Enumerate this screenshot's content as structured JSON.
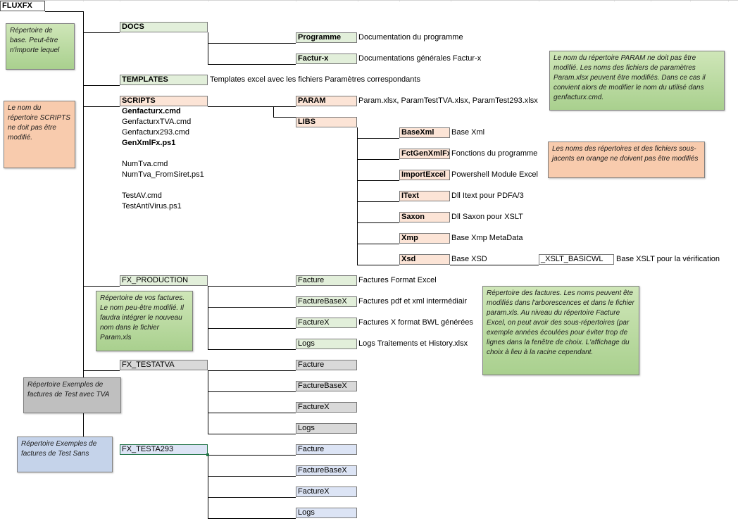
{
  "root": {
    "label": "FLUXFX"
  },
  "docs": {
    "label": "DOCS",
    "items": [
      {
        "label": "Programme",
        "desc": "Documentation du programme"
      },
      {
        "label": "Factur-x",
        "desc": "Documentations générales Factur-x"
      }
    ]
  },
  "templates": {
    "label": "TEMPLATES",
    "desc": "Templates excel avec les fichiers Paramètres correspondants"
  },
  "scripts": {
    "label": "SCRIPTS",
    "files": [
      {
        "name": "Genfacturx.cmd",
        "bold": true
      },
      {
        "name": "GenfacturxTVA.cmd",
        "bold": false
      },
      {
        "name": "Genfacturx293.cmd",
        "bold": false
      },
      {
        "name": "GenXmlFx.ps1",
        "bold": true
      },
      {
        "name": "NumTva.cmd",
        "bold": false
      },
      {
        "name": "NumTva_FromSiret.ps1",
        "bold": false
      },
      {
        "name": "TestAV.cmd",
        "bold": false
      },
      {
        "name": "TestAntiVirus.ps1",
        "bold": false
      }
    ],
    "param": {
      "label": "PARAM",
      "desc": "Param.xlsx, ParamTestTVA.xlsx, ParamTest293.xlsx"
    },
    "libs": {
      "label": "LIBS",
      "items": [
        {
          "label": "BaseXml",
          "desc": "Base Xml"
        },
        {
          "label": "FctGenXmlFx",
          "desc": "Fonctions du programme"
        },
        {
          "label": "ImportExcel",
          "desc": "Powershell Module Excel"
        },
        {
          "label": "IText",
          "desc": "Dll Itext pour PDFA/3"
        },
        {
          "label": "Saxon",
          "desc": "Dll Saxon pour XSLT"
        },
        {
          "label": "Xmp",
          "desc": "Base Xmp MetaData"
        },
        {
          "label": "Xsd",
          "desc": "Base XSD"
        }
      ],
      "sub": {
        "label": "_XSLT_BASICWL",
        "desc": "Base XSLT pour la vérification"
      }
    }
  },
  "production": {
    "label": "FX_PRODUCTION",
    "items": [
      {
        "label": "Facture",
        "desc": "Factures Format Excel"
      },
      {
        "label": "FactureBaseX",
        "desc": "Factures pdf et xml intermédiair"
      },
      {
        "label": "FactureX",
        "desc": "Factures X format BWL générées"
      },
      {
        "label": "Logs",
        "desc": "Logs Traitements et History.xlsx"
      }
    ]
  },
  "testatva": {
    "label": "FX_TESTATVA",
    "items": [
      {
        "label": "Facture"
      },
      {
        "label": "FactureBaseX"
      },
      {
        "label": "FactureX"
      },
      {
        "label": "Logs"
      }
    ]
  },
  "testa293": {
    "label": "FX_TESTA293",
    "items": [
      {
        "label": "Facture"
      },
      {
        "label": "FactureBaseX"
      },
      {
        "label": "FactureX"
      },
      {
        "label": "Logs"
      }
    ]
  },
  "notes": {
    "base": "Répertoire de base. Peut-être n'importe lequel",
    "scripts": "Le nom du répertoire SCRIPTS ne doit pas être modifié.",
    "param": "Le nom du répertoire PARAM ne doit pas être modifié. Les noms des fichiers de paramètres Param.xlsx peuvent être modifiés. Dans ce cas il convient alors de modifier le nom du utilisé dans genfacturx.cmd.",
    "orange": "Les noms des répertoires et des fichiers sous-jacents en orange ne doivent pas être modifiés",
    "production": "Répertoire de vos factures. Le nom peu-être modifié. Il faudra intégrer le nouveau nom dans le fichier Param.xls",
    "factures": "Répertoire des factures. Les noms peuvent ête modifiés dans l'arborescences et dans le fichier param.xls. Au niveau du répertoire Facture Excel, on peut avoir des sous-répertoires (par exemple années écoulées pour éviter trop de lignes dans la fenêtre de choix. L'affichage du choix à lieu à la racine cependant.",
    "tva": "Répertoire Exemples de factures de Test avec TVA",
    "sans": "Répertoire Exemples de factures de Test Sans"
  }
}
